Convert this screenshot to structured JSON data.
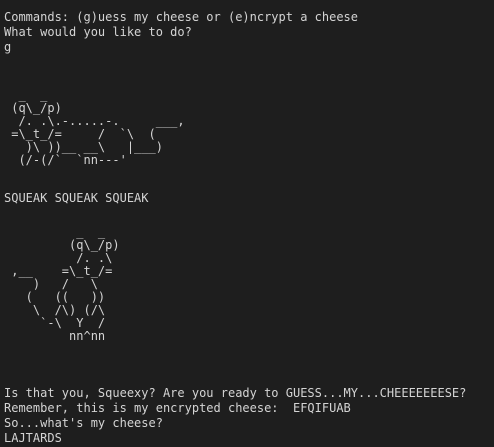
{
  "terminal": {
    "prompt_commands": "Commands: (g)uess my cheese or (e)ncrypt a cheese",
    "prompt_question": "What would you like to do?",
    "user_choice": "g",
    "mouse_art_1": "  _  _\n (q\\_/p)\n  /. .\\.-.....-.     ___,\n =\\_t_/=     /  `\\  (\n   )\\ ))__ __\\   |___)\n  (/-(/`  `nn---'",
    "squeak": "SQUEAK SQUEAK SQUEAK",
    "mouse_art_2": "          _  _\n         (q\\_/p)\n          /. .\\\n ,__    =\\_t_/=\n    )   /   \\\n   (   ((   ))\n    \\  /\\) (/\\\n     `-\\  Y  /\n         nn^nn",
    "challenge_line": "Is that you, Squeexy? Are you ready to GUESS...MY...CHEEEEEEESE?",
    "remember_line": "Remember, this is my encrypted cheese:  EFQIFUAB",
    "question_line": "So...what's my cheese?",
    "user_answer": "LAJTARDS"
  }
}
